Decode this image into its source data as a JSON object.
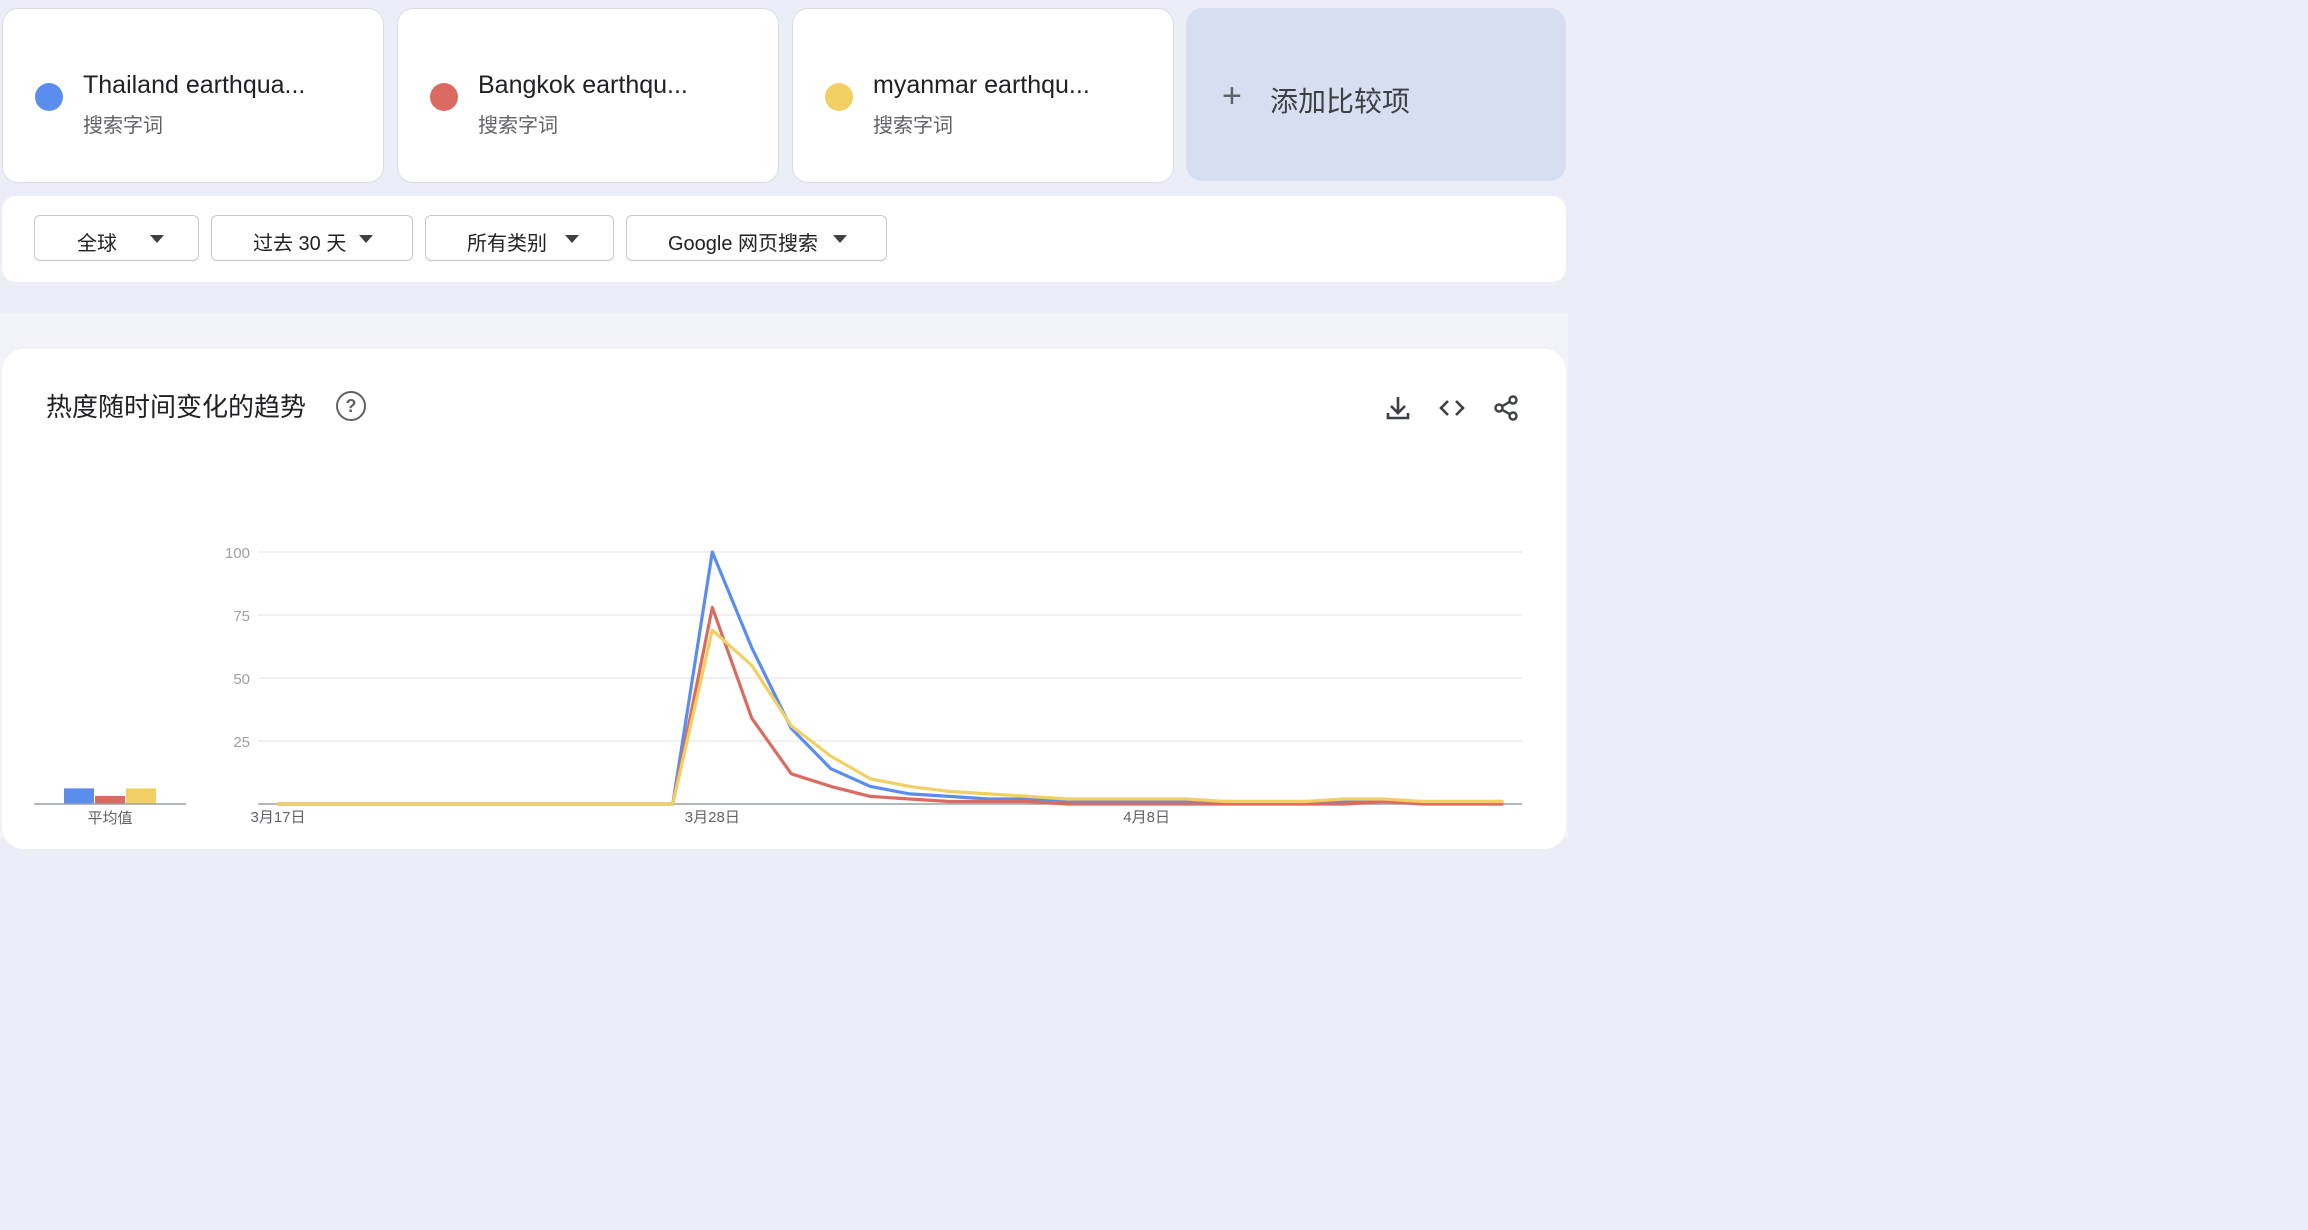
{
  "terms": [
    {
      "name": "Thailand earthqua...",
      "type": "搜索字词",
      "color": "#5b8def"
    },
    {
      "name": "Bangkok earthqu...",
      "type": "搜索字词",
      "color": "#db6b60"
    },
    {
      "name": "myanmar earthqu...",
      "type": "搜索字词",
      "color": "#f2cf63"
    }
  ],
  "add_compare": {
    "icon": "plus-icon",
    "plus": "+",
    "label": "添加比较项"
  },
  "filters": [
    {
      "label": "全球"
    },
    {
      "label": "过去 30 天"
    },
    {
      "label": "所有类别"
    },
    {
      "label": "Google 网页搜索"
    }
  ],
  "panel": {
    "title": "热度随时间变化的趋势",
    "help": "?",
    "tools": [
      "download-icon",
      "embed-code-icon",
      "share-icon"
    ]
  },
  "chart_data": {
    "type": "line",
    "x_tick_labels": [
      "3月17日",
      "3月28日",
      "4月8日"
    ],
    "y_ticks": [
      100,
      75,
      50,
      25
    ],
    "ylim": [
      0,
      100
    ],
    "grid": true,
    "average_label": "平均值",
    "averages": [
      6,
      3,
      6
    ],
    "series": [
      {
        "name": "Thailand earthqua...",
        "color": "#5b8def",
        "values": [
          0,
          0,
          0,
          0,
          0,
          0,
          0,
          0,
          0,
          0,
          0,
          100,
          62,
          30,
          14,
          7,
          4,
          3,
          2,
          2,
          1,
          1,
          1,
          1,
          1,
          1,
          1,
          1,
          1,
          1,
          1,
          1
        ]
      },
      {
        "name": "Bangkok earthqu...",
        "color": "#db6b60",
        "values": [
          0,
          0,
          0,
          0,
          0,
          0,
          0,
          0,
          0,
          0,
          0,
          78,
          34,
          12,
          7,
          3,
          2,
          1,
          1,
          1,
          0,
          0,
          0,
          0,
          0,
          0,
          0,
          0,
          1,
          0,
          0,
          0
        ]
      },
      {
        "name": "myanmar earthqu...",
        "color": "#f2cf63",
        "values": [
          0,
          0,
          0,
          0,
          0,
          0,
          0,
          0,
          0,
          0,
          0,
          69,
          55,
          31,
          19,
          10,
          7,
          5,
          4,
          3,
          2,
          2,
          2,
          2,
          1,
          1,
          1,
          2,
          2,
          1,
          1,
          1
        ]
      }
    ]
  }
}
